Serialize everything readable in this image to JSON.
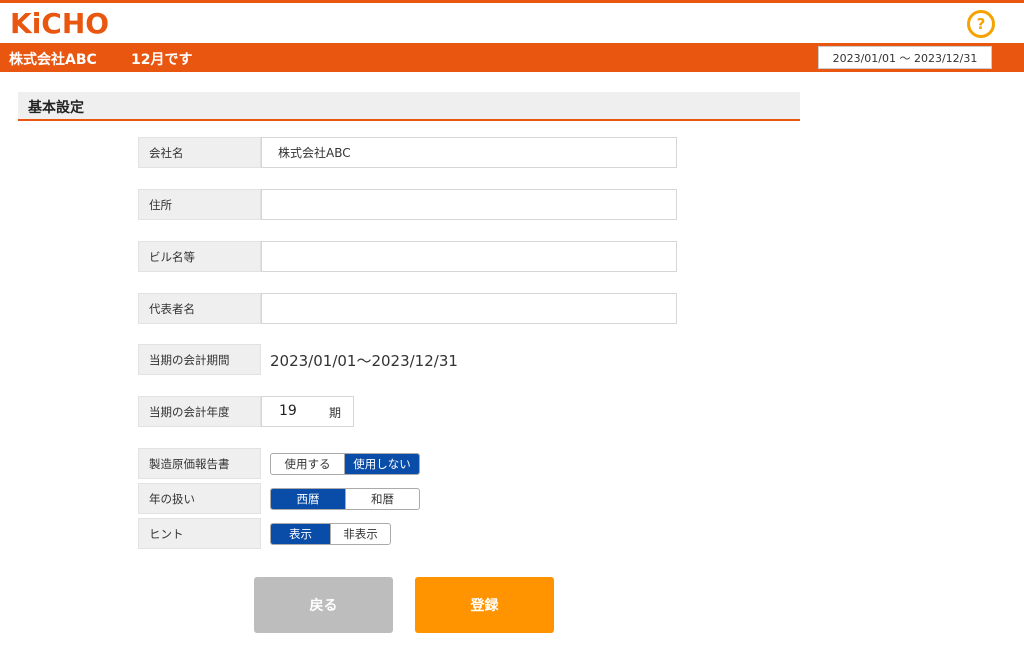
{
  "brand": {
    "logo_text": "KiCHO"
  },
  "header": {
    "help_glyph": "?",
    "company_name": "株式会社ABC",
    "month_text": "12月です",
    "period_range": "2023/01/01 〜 2023/12/31"
  },
  "section": {
    "title": "基本設定"
  },
  "form": {
    "company": {
      "label": "会社名",
      "value": "株式会社ABC"
    },
    "address": {
      "label": "住所",
      "value": ""
    },
    "building": {
      "label": "ビル名等",
      "value": ""
    },
    "representative": {
      "label": "代表者名",
      "value": ""
    },
    "accounting_period": {
      "label": "当期の会計期間",
      "value": "2023/01/01〜2023/12/31"
    },
    "fiscal_year": {
      "label": "当期の会計年度",
      "value": "19",
      "unit": "期"
    },
    "manufacturing_report": {
      "label": "製造原価報告書",
      "options": [
        "使用する",
        "使用しない"
      ],
      "selected": "使用しない"
    },
    "year_format": {
      "label": "年の扱い",
      "options": [
        "西暦",
        "和暦"
      ],
      "selected": "西暦"
    },
    "hint": {
      "label": "ヒント",
      "options": [
        "表示",
        "非表示"
      ],
      "selected": "表示"
    }
  },
  "buttons": {
    "back": "戻る",
    "register": "登録"
  },
  "colors": {
    "accent": "#e8560f",
    "toggle_active": "#0a4da8",
    "register": "#ff9300",
    "back": "#bdbdbd",
    "help": "#f5a300"
  }
}
